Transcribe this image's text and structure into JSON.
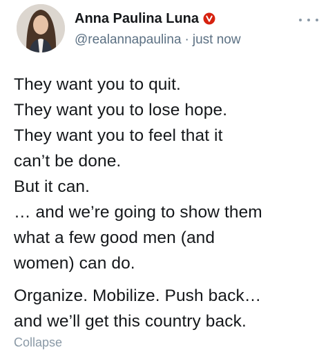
{
  "header": {
    "display_name": "Anna Paulina Luna",
    "handle": "@realannapaulina",
    "separator": "·",
    "timestamp": "just now",
    "verified_icon": "verified-badge-icon",
    "verified_color": "#d6220f",
    "more_icon": "more-horizontal-icon"
  },
  "body": {
    "paragraphs": [
      {
        "lines": [
          "They want you to quit.",
          "They want you to lose hope.",
          "They want you to feel that it",
          "can’t be done.",
          "But it can.",
          "… and we’re going to show them",
          "what a few good men (and",
          "women) can do."
        ]
      },
      {
        "lines": [
          "Organize. Mobilize. Push back…",
          "and we’ll get this country back."
        ]
      }
    ]
  },
  "footer": {
    "collapse_label": "Collapse"
  },
  "colors": {
    "text": "#14171a",
    "secondary_text": "#5b7083",
    "background": "#ffffff"
  }
}
